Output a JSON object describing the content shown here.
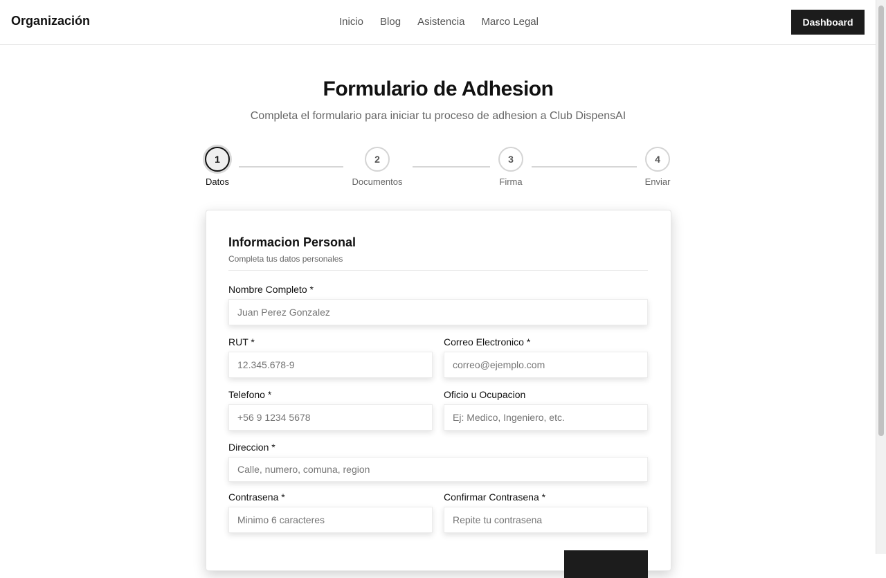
{
  "header": {
    "brand": "Organización",
    "nav": [
      "Inicio",
      "Blog",
      "Asistencia",
      "Marco Legal"
    ],
    "dashboard_label": "Dashboard"
  },
  "page": {
    "title": "Formulario de Adhesion",
    "subtitle": "Completa el formulario para iniciar tu proceso de adhesion a Club DispensAI"
  },
  "steps": [
    {
      "number": "1",
      "label": "Datos",
      "active": true
    },
    {
      "number": "2",
      "label": "Documentos",
      "active": false
    },
    {
      "number": "3",
      "label": "Firma",
      "active": false
    },
    {
      "number": "4",
      "label": "Enviar",
      "active": false
    }
  ],
  "form": {
    "title": "Informacion Personal",
    "description": "Completa tus datos personales",
    "fields": {
      "nombre": {
        "label": "Nombre Completo *",
        "placeholder": "Juan Perez Gonzalez",
        "value": ""
      },
      "rut": {
        "label": "RUT *",
        "placeholder": "12.345.678-9",
        "value": ""
      },
      "correo": {
        "label": "Correo Electronico *",
        "placeholder": "correo@ejemplo.com",
        "value": ""
      },
      "telefono": {
        "label": "Telefono *",
        "placeholder": "+56 9 1234 5678",
        "value": ""
      },
      "oficio": {
        "label": "Oficio u Ocupacion",
        "placeholder": "Ej: Medico, Ingeniero, etc.",
        "value": ""
      },
      "direccion": {
        "label": "Direccion *",
        "placeholder": "Calle, numero, comuna, region",
        "value": ""
      },
      "contrasena": {
        "label": "Contrasena *",
        "placeholder": "Minimo 6 caracteres",
        "value": ""
      },
      "confirmar": {
        "label": "Confirmar Contrasena *",
        "placeholder": "Repite tu contrasena",
        "value": ""
      }
    }
  },
  "colors": {
    "primary": "#1c1c1c",
    "muted": "#666666",
    "border": "#e5e5e5"
  }
}
